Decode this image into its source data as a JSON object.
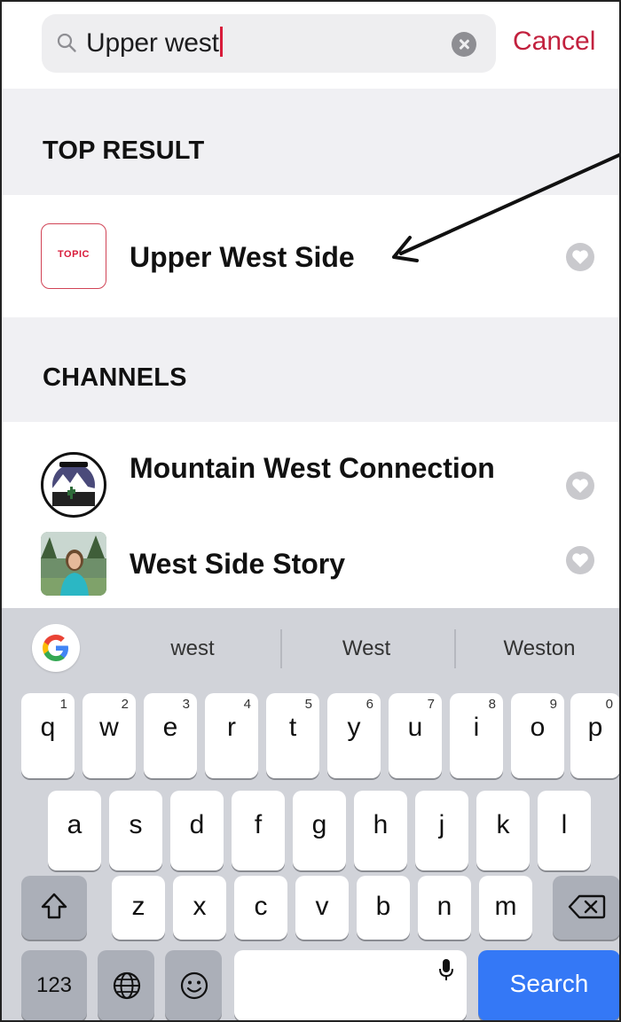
{
  "search": {
    "query": "Upper west",
    "cancel_label": "Cancel"
  },
  "sections": {
    "top_result_heading": "TOP RESULT",
    "channels_heading": "CHANNELS"
  },
  "top_result": {
    "badge": "TOPIC",
    "title": "Upper West Side"
  },
  "channels": [
    {
      "title": "Mountain West Connection"
    },
    {
      "title": "West Side Story"
    }
  ],
  "keyboard": {
    "suggestions": [
      "west",
      "West",
      "Weston"
    ],
    "row1": [
      {
        "ch": "q",
        "num": "1"
      },
      {
        "ch": "w",
        "num": "2"
      },
      {
        "ch": "e",
        "num": "3"
      },
      {
        "ch": "r",
        "num": "4"
      },
      {
        "ch": "t",
        "num": "5"
      },
      {
        "ch": "y",
        "num": "6"
      },
      {
        "ch": "u",
        "num": "7"
      },
      {
        "ch": "i",
        "num": "8"
      },
      {
        "ch": "o",
        "num": "9"
      },
      {
        "ch": "p",
        "num": "0"
      }
    ],
    "row2": [
      "a",
      "s",
      "d",
      "f",
      "g",
      "h",
      "j",
      "k",
      "l"
    ],
    "row3": [
      "z",
      "x",
      "c",
      "v",
      "b",
      "n",
      "m"
    ],
    "numbers_label": "123",
    "search_label": "Search"
  },
  "colors": {
    "accent": "#c2213e",
    "search_key": "#3478f6"
  },
  "icons": {
    "search": "magnifier",
    "clear": "x-circle",
    "favorite": "heart",
    "shift": "shift-arrow",
    "delete": "backspace",
    "globe": "globe",
    "emoji": "smiley",
    "mic": "microphone"
  }
}
